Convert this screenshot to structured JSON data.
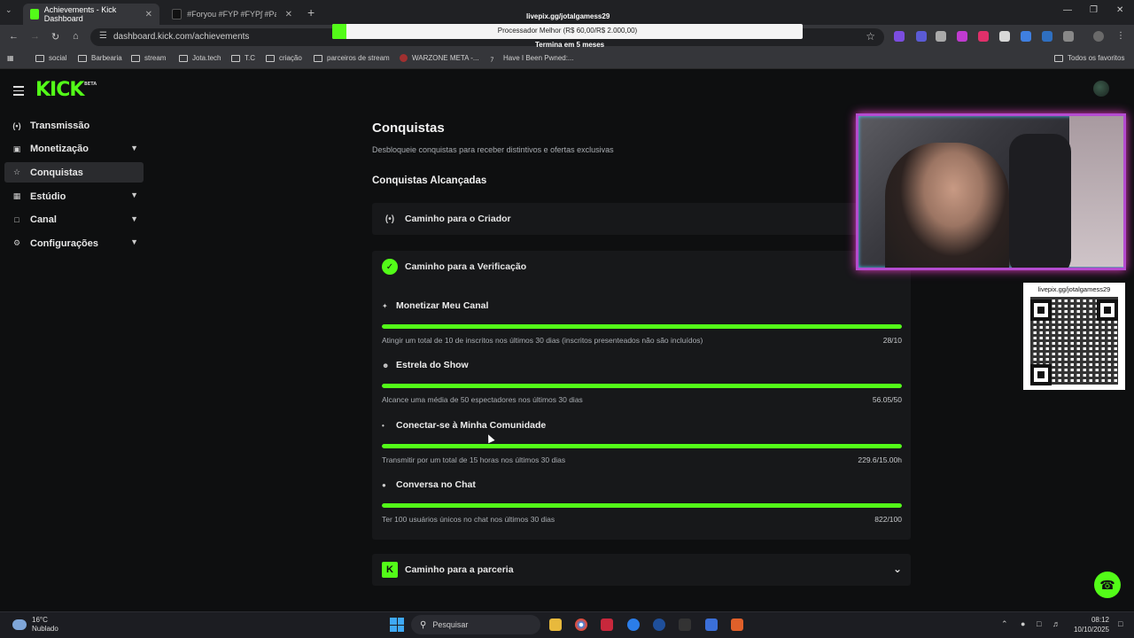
{
  "browser": {
    "tabs": [
      {
        "title": "Achievements - Kick Dashboard",
        "active": true
      },
      {
        "title": "#Foryou #FYP #FYPʃ #ParaVo…",
        "active": false
      }
    ],
    "url": "dashboard.kick.com/achievements",
    "bookmarks": [
      "social",
      "Barbearia",
      "stream",
      "Jota.tech",
      "T.C",
      "criação",
      "parceiros de stream",
      "WARZONE META -...",
      "Have I Been Pwned:...",
      "Todos os favoritos"
    ]
  },
  "overlay": {
    "handle": "livepix.gg/jotalgamess29",
    "goal_text": "Processador Melhor (R$ 60,00/R$ 2.000,00)",
    "goal_progress": 0.03,
    "goal_sub": "Termina em 5 meses",
    "qr_label": "livepix.gg/jotalgamess29"
  },
  "app": {
    "logo": "KICK",
    "logo_badge": "BETA",
    "sidebar": [
      {
        "label": "Transmissão",
        "icon": "broadcast-icon",
        "chevron": false,
        "active": false
      },
      {
        "label": "Monetização",
        "icon": "monetization-icon",
        "chevron": true,
        "active": false
      },
      {
        "label": "Conquistas",
        "icon": "trophy-icon",
        "chevron": false,
        "active": true
      },
      {
        "label": "Estúdio",
        "icon": "studio-icon",
        "chevron": true,
        "active": false
      },
      {
        "label": "Canal",
        "icon": "channel-icon",
        "chevron": true,
        "active": false
      },
      {
        "label": "Configurações",
        "icon": "gear-icon",
        "chevron": true,
        "active": false
      }
    ],
    "title": "Conquistas",
    "subtitle": "Desbloqueie conquistas para receber distintivos e ofertas exclusivas",
    "section_title": "Conquistas Alcançadas",
    "cards": {
      "creator": "Caminho para o Criador",
      "verification": "Caminho para a Verificação",
      "partnership": "Caminho para a parceria"
    },
    "requirements": [
      {
        "title": "Monetizar Meu Canal",
        "desc": "Atingir um total de 10 de inscritos nos últimos 30 dias (inscritos presenteados não são incluídos)",
        "value": "28/10",
        "progress": 1.0
      },
      {
        "title": "Estrela do Show",
        "desc": "Alcance uma média de 50 espectadores nos últimos 30 dias",
        "value": "56.05/50",
        "progress": 1.0
      },
      {
        "title": "Conectar-se à Minha Comunidade",
        "desc": "Transmitir por um total de 15 horas nos últimos 30 dias",
        "value": "229.6/15.00h",
        "progress": 1.0
      },
      {
        "title": "Conversa no Chat",
        "desc": "Ter 100 usuários únicos no chat nos últimos 30 dias",
        "value": "822/100",
        "progress": 1.0
      }
    ]
  },
  "taskbar": {
    "weather_temp": "16°C",
    "weather_desc": "Nublado",
    "search_placeholder": "Pesquisar",
    "time": "08:12",
    "date": "10/10/2025"
  },
  "colors": {
    "accent": "#53fc18",
    "background": "#0e0f10",
    "card": "#17181a"
  }
}
